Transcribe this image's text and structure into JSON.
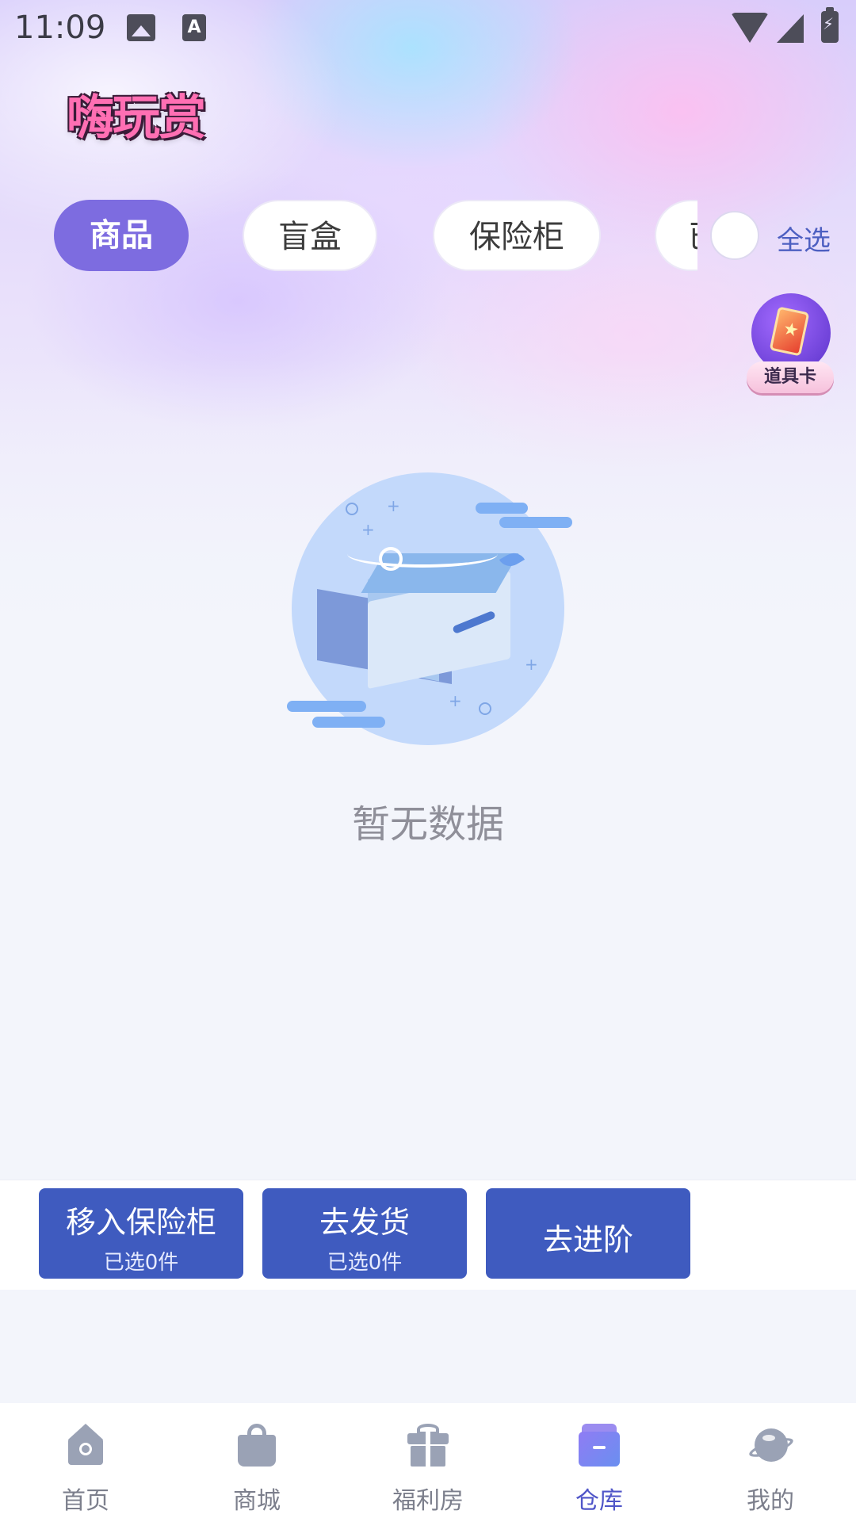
{
  "status_bar": {
    "time": "11:09",
    "icons": [
      "gallery-icon",
      "font-a-icon",
      "wifi-icon",
      "signal-icon",
      "battery-charging-icon"
    ]
  },
  "header": {
    "logo_text": "嗨玩赏"
  },
  "tabs": [
    {
      "label": "商品",
      "active": true
    },
    {
      "label": "盲盒",
      "active": false
    },
    {
      "label": "保险柜",
      "active": false
    },
    {
      "label": "已",
      "active": false
    }
  ],
  "select_all": {
    "label": "全选",
    "checked": false
  },
  "prop_card": {
    "label": "道具卡"
  },
  "empty_state": {
    "text": "暂无数据"
  },
  "actions": [
    {
      "label": "移入保险柜",
      "sub": "已选0件"
    },
    {
      "label": "去发货",
      "sub": "已选0件"
    },
    {
      "label": "去进阶"
    }
  ],
  "bottom_nav": [
    {
      "label": "首页",
      "icon": "home-icon",
      "active": false
    },
    {
      "label": "商城",
      "icon": "shopping-bag-icon",
      "active": false
    },
    {
      "label": "福利房",
      "icon": "gift-icon",
      "active": false
    },
    {
      "label": "仓库",
      "icon": "warehouse-icon",
      "active": true
    },
    {
      "label": "我的",
      "icon": "planet-icon",
      "active": false
    }
  ],
  "colors": {
    "accent": "#7d6ce0",
    "button": "#3f5bbf",
    "nav_active": "#4f55c8",
    "nav_inactive": "#9aa2b5"
  }
}
